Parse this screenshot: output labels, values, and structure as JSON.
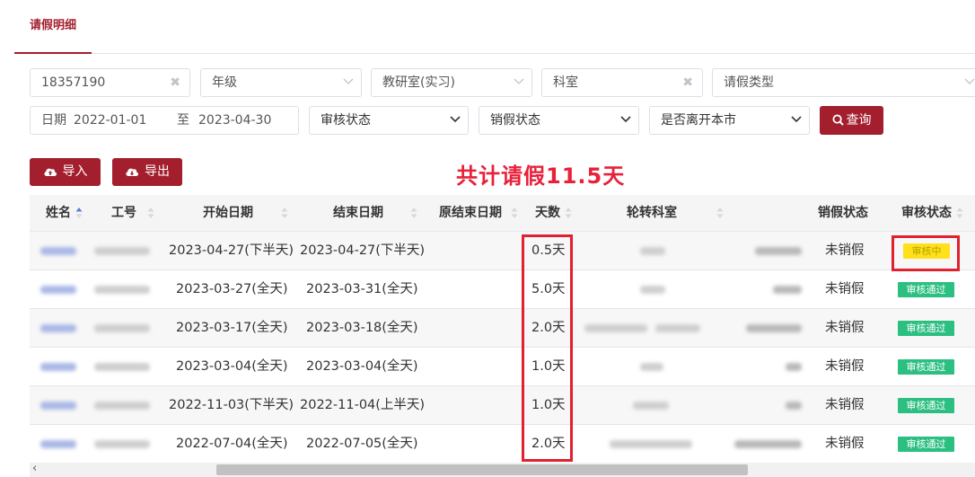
{
  "tab": {
    "label": "请假明细"
  },
  "filters": {
    "employee_id": "18357190",
    "grade": "年级",
    "teaching_office": "教研室(实习)",
    "department": "科室",
    "leave_type": "请假类型",
    "date_label": "日期",
    "date_start": "2022-01-01",
    "date_sep": "至",
    "date_end": "2023-04-30",
    "review_status": "审核状态",
    "cancel_status": "销假状态",
    "leave_city": "是否离开本市",
    "query_label": "查询"
  },
  "actions": {
    "import_label": "导入",
    "export_label": "导出"
  },
  "total_note": "共计请假11.5天",
  "table": {
    "columns": [
      "姓名",
      "工号",
      "开始日期",
      "结束日期",
      "原结束日期",
      "天数",
      "轮转科室",
      "销假状态",
      "审核状态"
    ],
    "rows": [
      {
        "start": "2023-04-27(下半天)",
        "end": "2023-04-27(下半天)",
        "days": "0.5天",
        "cancel": "未销假",
        "review": "审核中"
      },
      {
        "start": "2023-03-27(全天)",
        "end": "2023-03-31(全天)",
        "days": "5.0天",
        "cancel": "未销假",
        "review": "审核通过"
      },
      {
        "start": "2023-03-17(全天)",
        "end": "2023-03-18(全天)",
        "days": "2.0天",
        "cancel": "未销假",
        "review": "审核通过"
      },
      {
        "start": "2023-03-04(全天)",
        "end": "2023-03-04(全天)",
        "days": "1.0天",
        "cancel": "未销假",
        "review": "审核通过"
      },
      {
        "start": "2022-11-03(下半天)",
        "end": "2022-11-04(上半天)",
        "days": "1.0天",
        "cancel": "未销假",
        "review": "审核通过"
      },
      {
        "start": "2022-07-04(全天)",
        "end": "2022-07-05(全天)",
        "days": "2.0天",
        "cancel": "未销假",
        "review": "审核通过"
      }
    ]
  },
  "colors": {
    "brand": "#a31f2e",
    "pass": "#2cbf82",
    "pending": "#ffe01a",
    "highlight": "#e0212f"
  },
  "icons": [
    "close-icon",
    "chevron-down-icon",
    "search-icon",
    "cloud-upload-icon",
    "cloud-download-icon",
    "sort-icon",
    "chevron-left-icon"
  ]
}
